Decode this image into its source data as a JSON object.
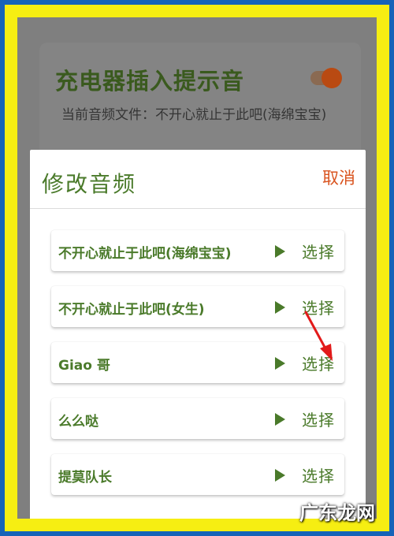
{
  "background_card": {
    "title": "充电器插入提示音",
    "subtitle": "当前音频文件：不开心就止于此吧(海绵宝宝)"
  },
  "dialog": {
    "title": "修改音频",
    "cancel_label": "取消",
    "items": [
      {
        "name": "不开心就止于此吧(海绵宝宝)",
        "choose_label": "选择"
      },
      {
        "name": "不开心就止于此吧(女生)",
        "choose_label": "选择"
      },
      {
        "name": "Giao 哥",
        "choose_label": "选择"
      },
      {
        "name": "么么哒",
        "choose_label": "选择"
      },
      {
        "name": "提莫队长",
        "choose_label": "选择"
      }
    ]
  },
  "icons": {
    "play": "play-icon",
    "arrow": "red-arrow-icon"
  },
  "colors": {
    "accent_green": "#4a7a2a",
    "cancel_orange": "#d9531e",
    "annotation_red": "#e21a1a"
  },
  "watermark": "广东龙网"
}
